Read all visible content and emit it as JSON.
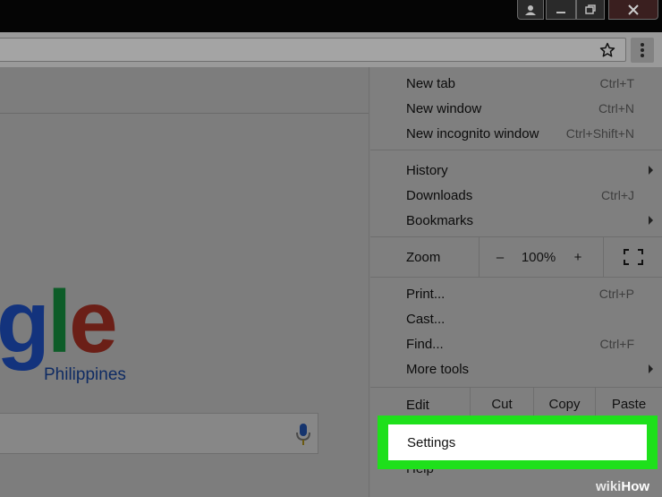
{
  "window": {
    "controls": [
      "user-icon",
      "minimize-icon",
      "restore-icon",
      "close-icon"
    ]
  },
  "toolbar": {
    "bookmark_icon": "star-icon",
    "menu_icon": "vertical-dots-icon"
  },
  "page": {
    "logo_visible_text": "gle",
    "logo_subtitle": "Philippines",
    "search_mic_icon": "microphone-icon"
  },
  "menu": {
    "new_tab": {
      "label": "New tab",
      "shortcut": "Ctrl+T"
    },
    "new_window": {
      "label": "New window",
      "shortcut": "Ctrl+N"
    },
    "incognito": {
      "label": "New incognito window",
      "shortcut": "Ctrl+Shift+N"
    },
    "history": {
      "label": "History"
    },
    "downloads": {
      "label": "Downloads",
      "shortcut": "Ctrl+J"
    },
    "bookmarks": {
      "label": "Bookmarks"
    },
    "zoom": {
      "label": "Zoom",
      "minus": "–",
      "value": "100%",
      "plus": "+",
      "fullscreen_icon": "fullscreen-icon"
    },
    "print": {
      "label": "Print...",
      "shortcut": "Ctrl+P"
    },
    "cast": {
      "label": "Cast..."
    },
    "find": {
      "label": "Find...",
      "shortcut": "Ctrl+F"
    },
    "more_tools": {
      "label": "More tools"
    },
    "edit": {
      "label": "Edit",
      "cut": "Cut",
      "copy": "Copy",
      "paste": "Paste"
    },
    "settings": {
      "label": "Settings"
    },
    "help": {
      "label": "Help"
    }
  },
  "highlight_color": "#1ee01b",
  "watermark": {
    "wiki": "wiki",
    "how": "How"
  }
}
